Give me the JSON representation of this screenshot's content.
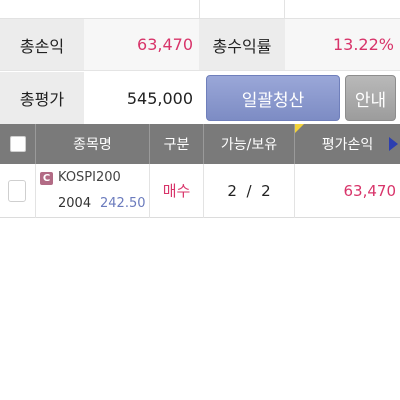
{
  "summary": {
    "total_profit_label": "총손익",
    "total_profit_value": "63,470",
    "total_return_label": "총수익률",
    "total_return_value": "13.22%",
    "total_eval_label": "총평가",
    "total_eval_value": "545,000"
  },
  "buttons": {
    "liquidate_all": "일괄청산",
    "info": "안내"
  },
  "table": {
    "headers": [
      "종목명",
      "구분",
      "가능/보유",
      "평가손익"
    ],
    "rows": [
      {
        "badge": "C",
        "name": "KOSPI200",
        "code": "2004",
        "price": "242.50",
        "side": "매수",
        "available": "2",
        "qty_sep": "/",
        "held": "2",
        "pl": "63,470"
      }
    ]
  },
  "colors": {
    "accent_pink": "#d8346a",
    "liquidate_button": "#8b99cf",
    "header_bg": "#7a7a7a",
    "price_blue": "#6b7bbd"
  },
  "icons": {
    "header_checkbox": "checkbox-icon",
    "scroll_right": "play-right-icon",
    "sort_flag": "triangle-flag-icon",
    "product_badge": "c-badge-icon"
  }
}
